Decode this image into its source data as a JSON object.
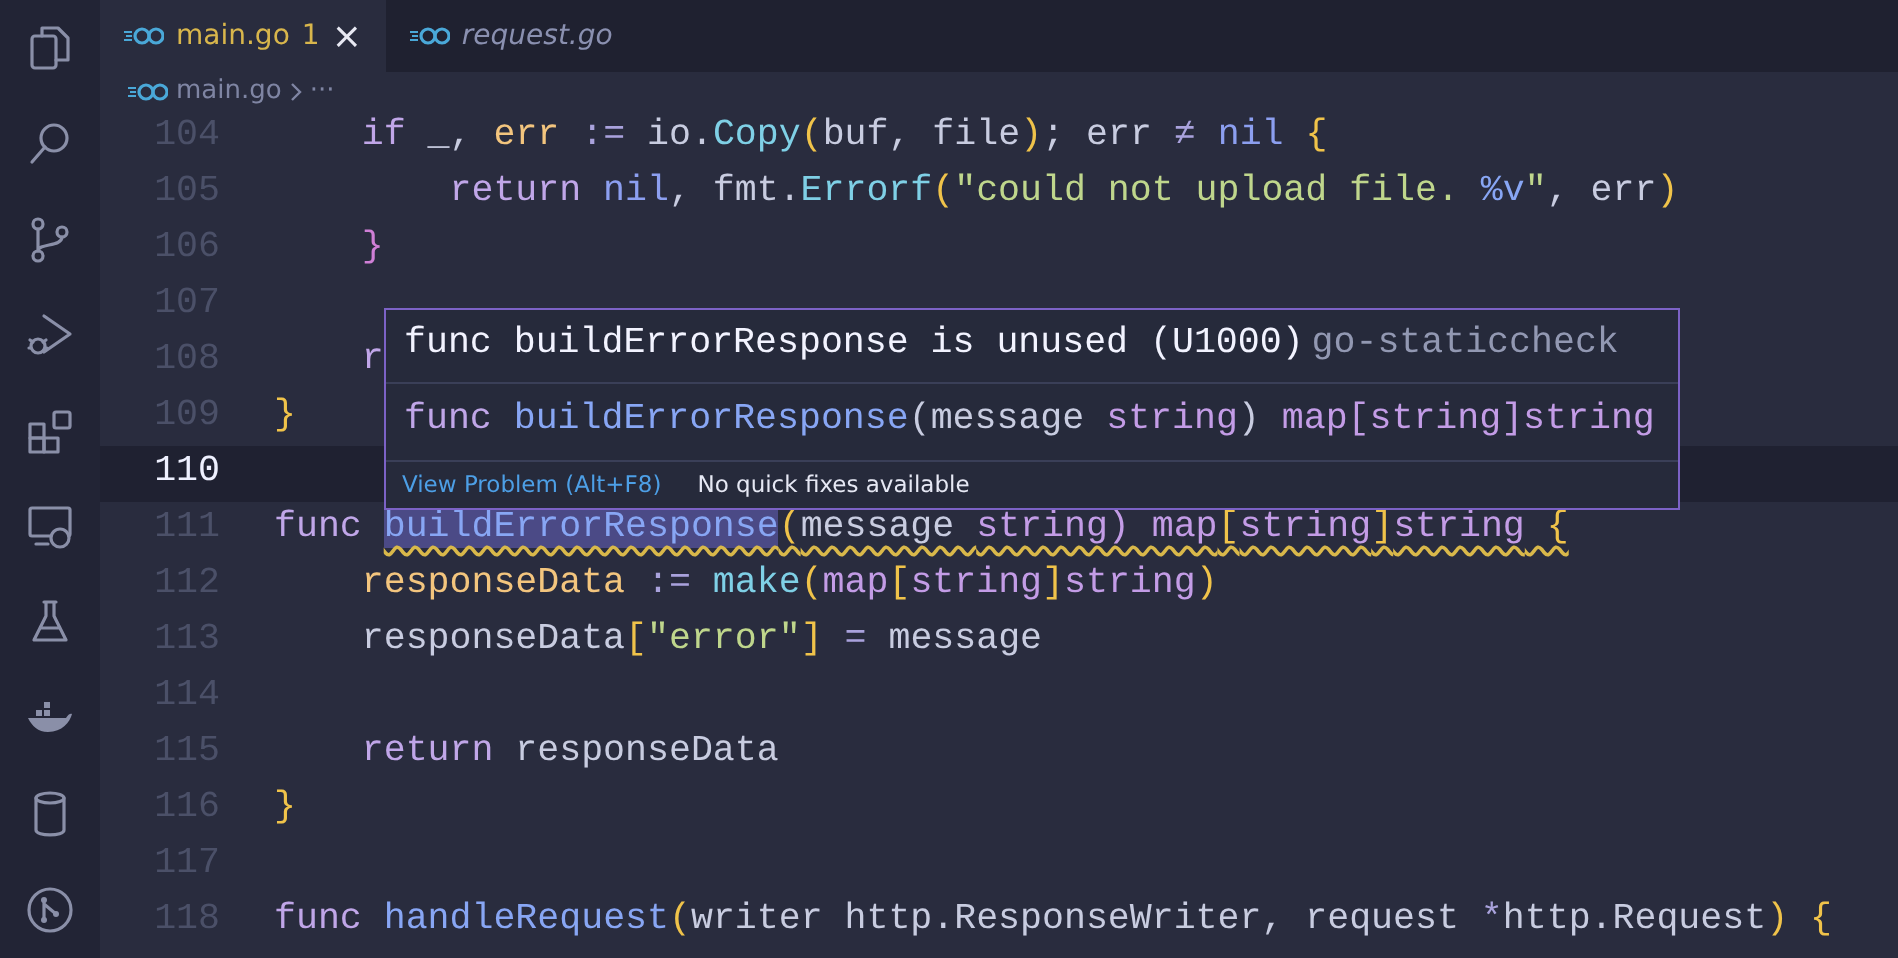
{
  "activity_bar": [
    {
      "kind": "files"
    },
    {
      "kind": "search"
    },
    {
      "kind": "source-control"
    },
    {
      "kind": "run-debug"
    },
    {
      "kind": "extensions"
    },
    {
      "kind": "remote"
    },
    {
      "kind": "testing"
    },
    {
      "kind": "docker"
    },
    {
      "kind": "database"
    },
    {
      "kind": "git-graph"
    }
  ],
  "tabs": [
    {
      "label": "main.go",
      "badge": "1",
      "close": "×",
      "selected": true,
      "preview": false
    },
    {
      "label": "request.go",
      "selected": false,
      "preview": true
    }
  ],
  "breadcrumb": {
    "file": "main.go",
    "more": "···"
  },
  "lines": [
    {
      "number": "104",
      "current": false,
      "tokens": [
        {
          "t": "    if",
          "kind": "kw"
        },
        {
          "t": " _, ",
          "kind": "pl"
        },
        {
          "t": "err",
          "kind": "var"
        },
        {
          "t": " := ",
          "kind": "op"
        },
        {
          "t": "io.",
          "kind": "pl"
        },
        {
          "t": "Copy",
          "kind": "bi"
        },
        {
          "t": "(",
          "kind": "br"
        },
        {
          "t": "buf, file",
          "kind": "pl"
        },
        {
          "t": ")",
          "kind": "br"
        },
        {
          "t": "; err ",
          "kind": "pl"
        },
        {
          "t": "≠ ",
          "kind": "op"
        },
        {
          "t": "nil",
          "kind": "cn"
        },
        {
          "t": " {",
          "kind": "br"
        }
      ]
    },
    {
      "number": "105",
      "current": false,
      "tokens": [
        {
          "t": "        return",
          "kind": "kw"
        },
        {
          "t": " nil",
          "kind": "cn"
        },
        {
          "t": ", fmt.",
          "kind": "pl"
        },
        {
          "t": "Errorf",
          "kind": "bi"
        },
        {
          "t": "(",
          "kind": "br"
        },
        {
          "t": "\"could not upload file. ",
          "kind": "str"
        },
        {
          "t": "%v",
          "kind": "fn"
        },
        {
          "t": "\"",
          "kind": "str"
        },
        {
          "t": ", err",
          "kind": "pl"
        },
        {
          "t": ")",
          "kind": "br"
        }
      ]
    },
    {
      "number": "106",
      "current": false,
      "tokens": [
        {
          "t": "    }",
          "kind": "br2"
        }
      ]
    },
    {
      "number": "107",
      "current": false
    },
    {
      "number": "108",
      "current": false,
      "tokens": [
        {
          "t": "    r",
          "kind": "kw"
        }
      ]
    },
    {
      "number": "109",
      "current": false,
      "tokens": [
        {
          "t": "}",
          "kind": "br"
        }
      ]
    },
    {
      "number": "110",
      "current": true
    },
    {
      "number": "111",
      "current": false,
      "tokens": [
        {
          "t": "func ",
          "kind": "kw"
        },
        {
          "t": "buildErrorResponse",
          "kind": "fn",
          "highlight": true,
          "squiggle": true
        },
        {
          "t": "(",
          "kind": "br",
          "squiggle": true
        },
        {
          "t": "message ",
          "kind": "pl",
          "squiggle": true
        },
        {
          "t": "string) map",
          "kind": "ty",
          "squiggle": true
        },
        {
          "t": "[",
          "kind": "br",
          "squiggle": true
        },
        {
          "t": "string",
          "kind": "ty",
          "squiggle": true
        },
        {
          "t": "]",
          "kind": "br",
          "squiggle": true
        },
        {
          "t": "string",
          "kind": "ty",
          "squiggle": true
        },
        {
          "t": " {",
          "kind": "br",
          "squiggle": true
        }
      ]
    },
    {
      "number": "112",
      "current": false,
      "tokens": [
        {
          "t": "    responseData",
          "kind": "var"
        },
        {
          "t": " := ",
          "kind": "op"
        },
        {
          "t": "make",
          "kind": "bi"
        },
        {
          "t": "(",
          "kind": "br"
        },
        {
          "t": "map",
          "kind": "ty"
        },
        {
          "t": "[",
          "kind": "br"
        },
        {
          "t": "string",
          "kind": "ty"
        },
        {
          "t": "]",
          "kind": "br"
        },
        {
          "t": "string",
          "kind": "ty"
        },
        {
          "t": ")",
          "kind": "br"
        }
      ]
    },
    {
      "number": "113",
      "current": false,
      "tokens": [
        {
          "t": "    responseData",
          "kind": "pl"
        },
        {
          "t": "[",
          "kind": "br"
        },
        {
          "t": "\"error\"",
          "kind": "str"
        },
        {
          "t": "]",
          "kind": "br"
        },
        {
          "t": " = ",
          "kind": "op"
        },
        {
          "t": "message",
          "kind": "pl"
        }
      ]
    },
    {
      "number": "114",
      "current": false
    },
    {
      "number": "115",
      "current": false,
      "tokens": [
        {
          "t": "    return",
          "kind": "kw"
        },
        {
          "t": " responseData",
          "kind": "pl"
        }
      ]
    },
    {
      "number": "116",
      "current": false,
      "tokens": [
        {
          "t": "}",
          "kind": "br"
        }
      ]
    },
    {
      "number": "117",
      "current": false
    },
    {
      "number": "118",
      "current": false,
      "tokens": [
        {
          "t": "func ",
          "kind": "kw"
        },
        {
          "t": "handleRequest",
          "kind": "fn"
        },
        {
          "t": "(",
          "kind": "br"
        },
        {
          "t": "writer http.ResponseWriter, request ",
          "kind": "pl"
        },
        {
          "t": "*",
          "kind": "op"
        },
        {
          "t": "http.Request",
          "kind": "pl"
        },
        {
          "t": ")",
          "kind": "br"
        },
        {
          "t": " {",
          "kind": "br"
        }
      ]
    }
  ],
  "hover": {
    "message": "func buildErrorResponse is unused (U1000)",
    "source": "go-staticcheck",
    "signature": [
      {
        "t": "func ",
        "kind": "kw"
      },
      {
        "t": "buildErrorResponse",
        "kind": "fn"
      },
      {
        "t": "(message ",
        "kind": "pl"
      },
      {
        "t": "string",
        "kind": "ty"
      },
      {
        "t": ") ",
        "kind": "pl"
      },
      {
        "t": "map",
        "kind": "ty"
      },
      {
        "t": "[string]string",
        "kind": "ty"
      }
    ],
    "actions": [
      {
        "label": "View Problem (Alt+F8)",
        "kind": "link"
      },
      {
        "label": "No quick fixes available",
        "kind": "text"
      }
    ]
  }
}
